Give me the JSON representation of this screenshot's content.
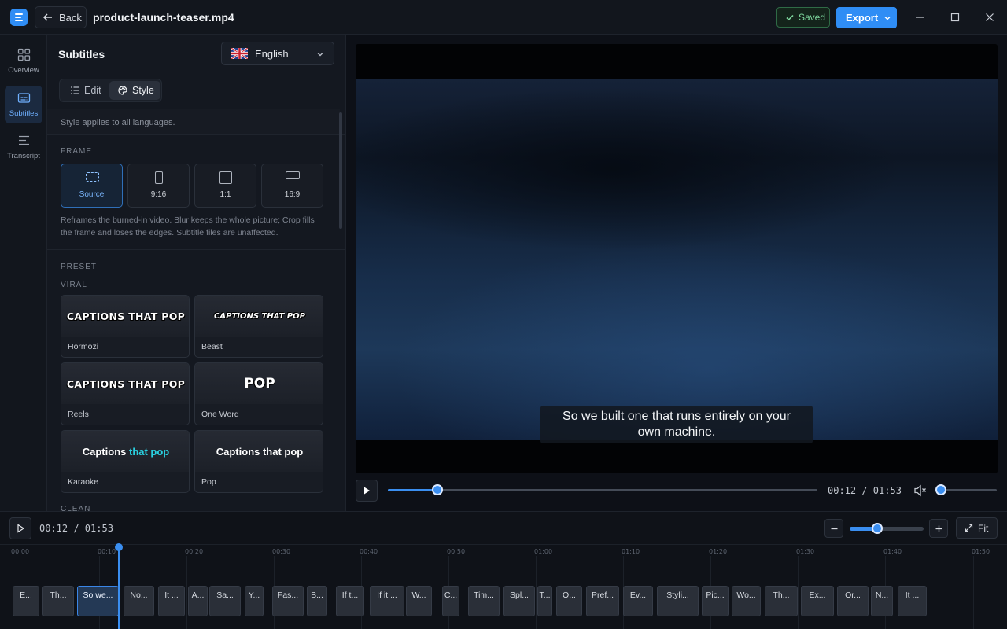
{
  "titlebar": {
    "back_label": "Back",
    "file_name": "product-launch-teaser.mp4",
    "saved_label": "Saved",
    "export_label": "Export"
  },
  "rail": {
    "items": [
      {
        "label": "Overview",
        "icon": "grid-icon",
        "active": false
      },
      {
        "label": "Subtitles",
        "icon": "captions-icon",
        "active": true
      },
      {
        "label": "Transcript",
        "icon": "lines-icon",
        "active": false
      }
    ]
  },
  "panel": {
    "title": "Subtitles",
    "language": "English",
    "tabs": [
      {
        "label": "Edit",
        "active": false
      },
      {
        "label": "Style",
        "active": true
      }
    ],
    "style_note": "Style applies to all languages.",
    "frame_label": "FRAME",
    "frame_options": [
      {
        "label": "Source",
        "active": true
      },
      {
        "label": "9:16",
        "active": false
      },
      {
        "label": "1:1",
        "active": false
      },
      {
        "label": "16:9",
        "active": false
      }
    ],
    "frame_description": "Reframes the burned-in video. Blur keeps the whole picture; Crop fills the frame and loses the edges. Subtitle files are unaffected.",
    "preset_label": "PRESET",
    "viral_label": "VIRAL",
    "clean_label": "CLEAN",
    "presets": [
      {
        "name": "Hormozi",
        "preview": "CAPTIONS THAT POP"
      },
      {
        "name": "Beast",
        "preview": "CAPTIONS THAT POP"
      },
      {
        "name": "Reels",
        "preview": "CAPTIONS THAT POP"
      },
      {
        "name": "One Word",
        "preview": "POP"
      },
      {
        "name": "Karaoke",
        "preview_a": "Captions ",
        "preview_b": "that pop"
      },
      {
        "name": "Pop",
        "preview": "Captions that pop"
      }
    ]
  },
  "video": {
    "subtitle_line1": "So we built one that runs entirely on your",
    "subtitle_line2": "own machine.",
    "current_time": "00:12",
    "duration": "01:53",
    "time_readout": "00:12 / 01:53",
    "progress_fraction": 0.115,
    "volume_fraction": 0.0
  },
  "timeline": {
    "time_readout": "00:12 / 01:53",
    "zoom_fraction": 0.37,
    "fit_label": "Fit",
    "ticks": [
      "00:00",
      "00:10",
      "00:20",
      "00:30",
      "00:40",
      "00:50",
      "01:00",
      "01:10",
      "01:20",
      "01:30",
      "01:40",
      "01:50"
    ],
    "clips": [
      {
        "text": "E..."
      },
      {
        "text": "Th..."
      },
      {
        "text": "So we...",
        "active": true
      },
      {
        "text": "No..."
      },
      {
        "text": "It ..."
      },
      {
        "text": "A..."
      },
      {
        "text": "Sa..."
      },
      {
        "text": "Y..."
      },
      {
        "text": "Fas..."
      },
      {
        "text": "B..."
      },
      {
        "text": "If t..."
      },
      {
        "text": "If it ..."
      },
      {
        "text": "W..."
      },
      {
        "text": "C..."
      },
      {
        "text": "Tim..."
      },
      {
        "text": "Spl..."
      },
      {
        "text": "T..."
      },
      {
        "text": "O..."
      },
      {
        "text": "Pref..."
      },
      {
        "text": "Ev..."
      },
      {
        "text": "Styli..."
      },
      {
        "text": "Pic..."
      },
      {
        "text": "Wo..."
      },
      {
        "text": "Th..."
      },
      {
        "text": "Ex..."
      },
      {
        "text": "Or..."
      },
      {
        "text": "N..."
      },
      {
        "text": "It ..."
      }
    ]
  },
  "colors": {
    "accent": "#2f8df5",
    "saved_green": "#7ed79e",
    "karaoke_highlight": "#2ad0e0"
  }
}
